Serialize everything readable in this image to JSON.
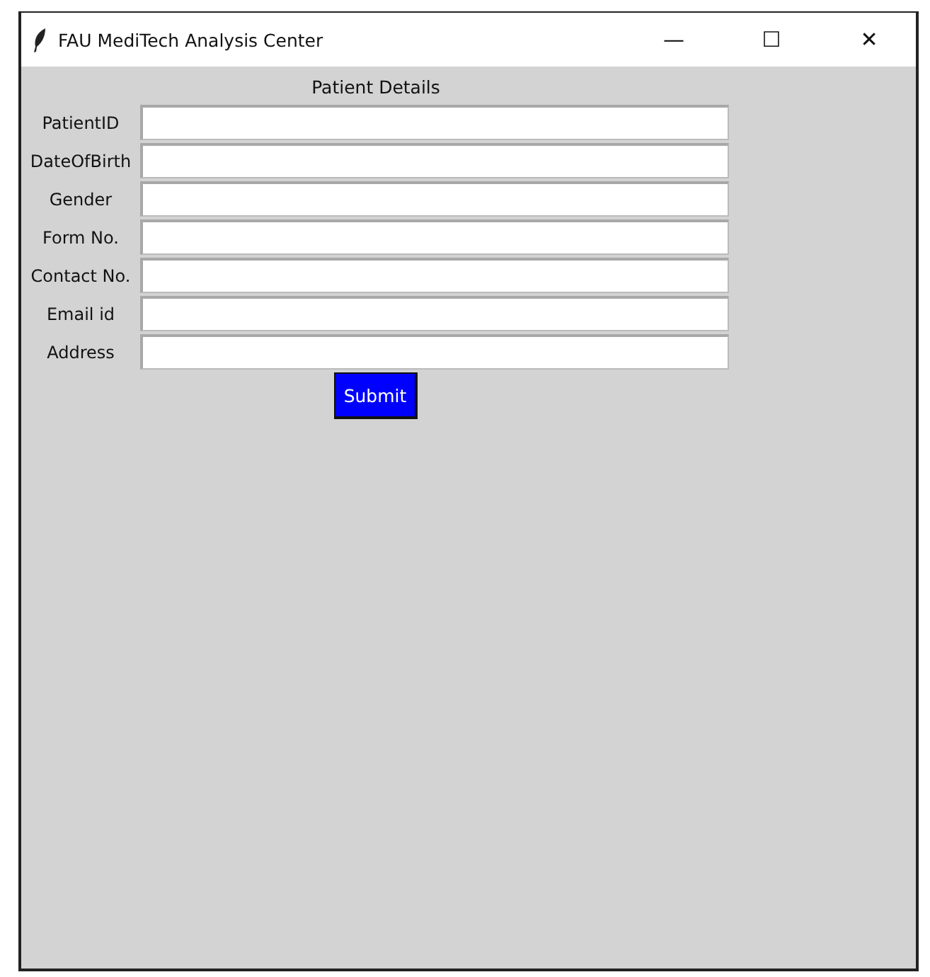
{
  "window": {
    "title": "FAU MediTech Analysis Center",
    "controls": [
      "—",
      "☐",
      "✕"
    ]
  },
  "form": {
    "heading": "Patient Details",
    "fields": [
      {
        "label": "PatientID"
      },
      {
        "label": "DateOfBirth"
      },
      {
        "label": "Gender"
      },
      {
        "label": "Form No."
      },
      {
        "label": "Contact No."
      },
      {
        "label": "Email id"
      },
      {
        "label": "Address"
      }
    ],
    "submit": "Submit"
  }
}
